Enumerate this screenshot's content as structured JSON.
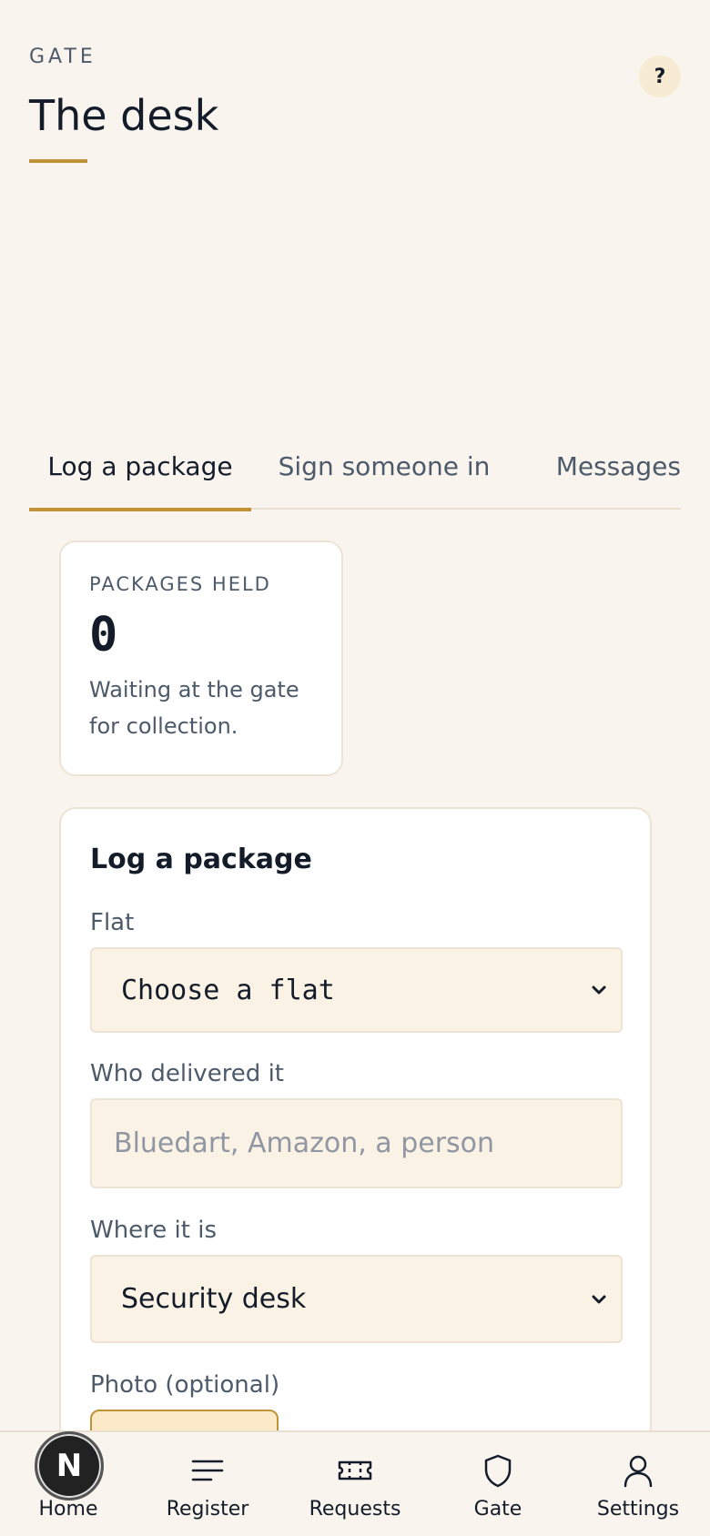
{
  "header": {
    "eyebrow": "GATE",
    "title": "The desk",
    "help_label": "?"
  },
  "tabs": [
    {
      "label": "Log a package",
      "active": true
    },
    {
      "label": "Sign someone in",
      "active": false
    },
    {
      "label": "Messages",
      "active": false
    }
  ],
  "stat": {
    "label": "PACKAGES HELD",
    "value": "0",
    "line1": "Waiting at the gate",
    "line2": "for collection."
  },
  "form": {
    "heading": "Log a package",
    "flat_label": "Flat",
    "flat_value": "Choose a flat",
    "delivered_label": "Who delivered it",
    "delivered_placeholder": "Bluedart, Amazon, a person",
    "location_label": "Where it is",
    "location_value": "Security desk",
    "photo_label": "Photo (optional)"
  },
  "nav": {
    "home_badge": "N",
    "items": [
      {
        "label": "Home",
        "icon": "home-icon"
      },
      {
        "label": "Register",
        "icon": "list-icon"
      },
      {
        "label": "Requests",
        "icon": "ticket-icon"
      },
      {
        "label": "Gate",
        "icon": "shield-icon"
      },
      {
        "label": "Settings",
        "icon": "user-icon"
      }
    ]
  },
  "colors": {
    "background": "#f9f5ee",
    "accent": "#c0923a",
    "field_bg": "#faf2e5"
  }
}
